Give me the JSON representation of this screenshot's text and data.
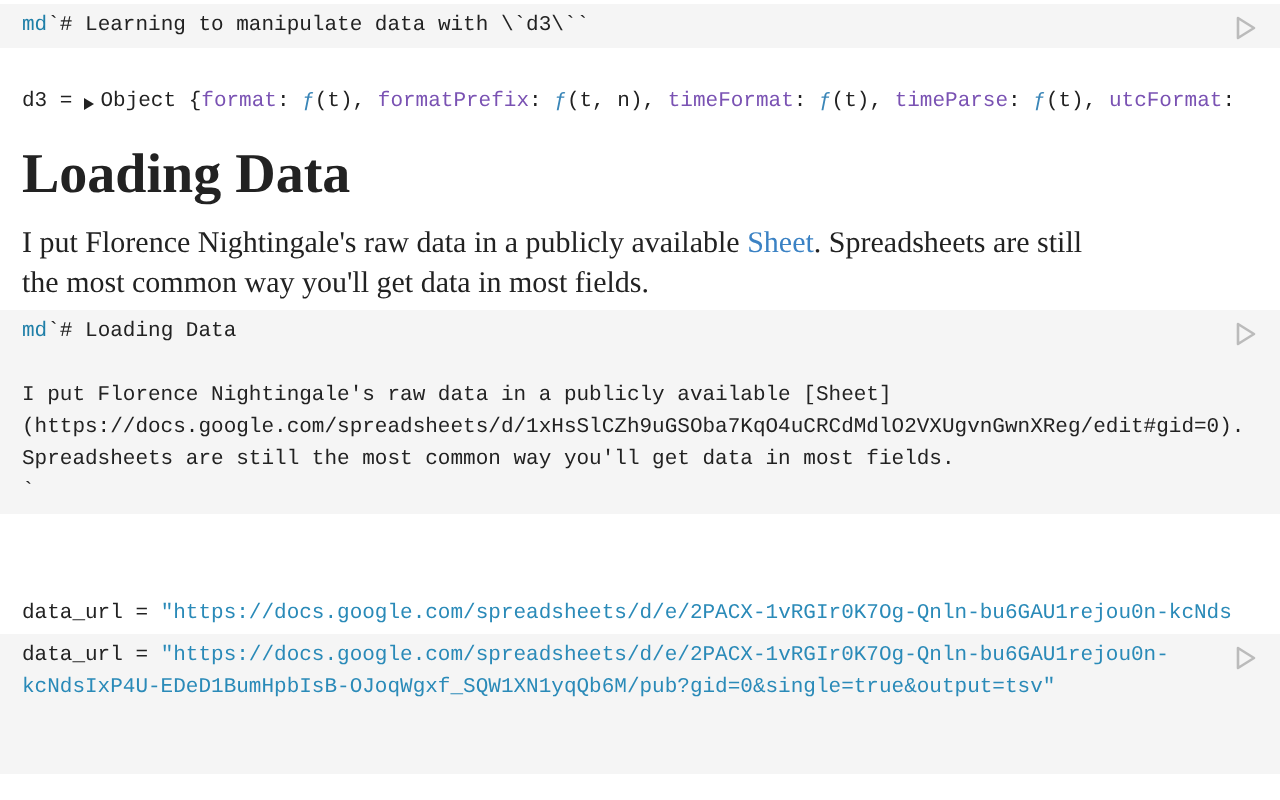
{
  "cells": [
    {
      "kind": "source",
      "lines": [
        {
          "kind": "code",
          "tokens": [
            {
              "t": "md",
              "kind": "tag"
            },
            {
              "t": "`# Learning to manipulate data with \\`d3\\``",
              "kind": "plain"
            }
          ]
        }
      ]
    },
    {
      "kind": "inspector",
      "name": "d3 =",
      "tokens": [
        {
          "t": "Object {",
          "kind": "plain"
        },
        {
          "t": "format",
          "kind": "key"
        },
        {
          "t": ": ",
          "kind": "plain"
        },
        {
          "t": "ƒ",
          "kind": "func"
        },
        {
          "t": "(t), ",
          "kind": "plain"
        },
        {
          "t": "formatPrefix",
          "kind": "key"
        },
        {
          "t": ": ",
          "kind": "plain"
        },
        {
          "t": "ƒ",
          "kind": "func"
        },
        {
          "t": "(t, n), ",
          "kind": "plain"
        },
        {
          "t": "timeFormat",
          "kind": "key"
        },
        {
          "t": ": ",
          "kind": "plain"
        },
        {
          "t": "ƒ",
          "kind": "func"
        },
        {
          "t": "(t), ",
          "kind": "plain"
        },
        {
          "t": "timeParse",
          "kind": "key"
        },
        {
          "t": ": ",
          "kind": "plain"
        },
        {
          "t": "ƒ",
          "kind": "func"
        },
        {
          "t": "(t), ",
          "kind": "plain"
        },
        {
          "t": "utcFormat",
          "kind": "key"
        },
        {
          "t": ":",
          "kind": "plain"
        }
      ]
    },
    {
      "kind": "heading",
      "text": "Loading Data"
    },
    {
      "kind": "paragraph",
      "parts": [
        {
          "t": "I put Florence Nightingale's raw data in a publicly available ",
          "kind": "text"
        },
        {
          "t": "Sheet",
          "kind": "link"
        },
        {
          "t": ". Spreadsheets are still the most common way you'll get data in most fields.",
          "kind": "text"
        }
      ]
    },
    {
      "kind": "source",
      "lines": [
        {
          "kind": "code",
          "tokens": [
            {
              "t": "md",
              "kind": "tag"
            },
            {
              "t": "`# Loading Data",
              "kind": "plain"
            }
          ]
        },
        {
          "kind": "blank"
        },
        {
          "kind": "code",
          "tokens": [
            {
              "t": "I put Florence Nightingale's raw data in a publicly available [Sheet]",
              "kind": "plain"
            }
          ]
        },
        {
          "kind": "code",
          "tokens": [
            {
              "t": "(https://docs.google.com/spreadsheets/d/1xHsSlCZh9uGSOba7KqO4uCRCdMdlO2VXUgvnGwnXReg/edit#gid=0).",
              "kind": "plain"
            }
          ]
        },
        {
          "kind": "code",
          "tokens": [
            {
              "t": "Spreadsheets are still the most common way you'll get data in most fields.",
              "kind": "plain"
            }
          ]
        },
        {
          "kind": "code",
          "tokens": [
            {
              "t": "`",
              "kind": "plain"
            }
          ]
        }
      ]
    },
    {
      "kind": "value",
      "lines": [
        {
          "kind": "code",
          "tokens": [
            {
              "t": "data_url = ",
              "kind": "plain"
            },
            {
              "t": "\"https://docs.google.com/spreadsheets/d/e/2PACX-1vRGIr0K7Og-Qnln-bu6GAU1rejou0n-kcNds",
              "kind": "string"
            }
          ]
        }
      ]
    },
    {
      "kind": "source",
      "lines": [
        {
          "kind": "code",
          "tokens": [
            {
              "t": "data_url = ",
              "kind": "plain"
            },
            {
              "t": "\"https://docs.google.com/spreadsheets/d/e/2PACX-1vRGIr0K7Og-Qnln-bu6GAU1rejou0n-",
              "kind": "string"
            }
          ]
        },
        {
          "kind": "code",
          "tokens": [
            {
              "t": "kcNdsIxP4U-EDeD1BumHpbIsB-OJoqWgxf_SQW1XN1yqQb6M/pub?gid=0&single=true&output=tsv\"",
              "kind": "string"
            }
          ]
        },
        {
          "kind": "blank"
        },
        {
          "kind": "blank"
        }
      ]
    }
  ]
}
